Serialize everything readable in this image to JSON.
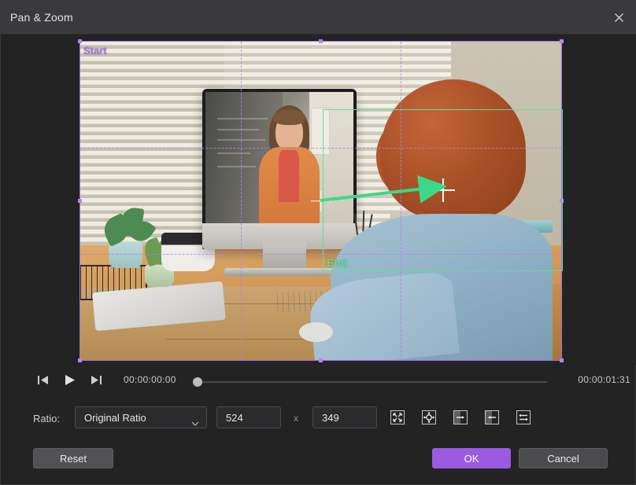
{
  "window": {
    "title": "Pan & Zoom",
    "close_icon": "close-icon"
  },
  "preview": {
    "start_marker_label": "Start",
    "end_marker_label": "End",
    "start_color": "#a46fe0",
    "end_color": "#57e29a",
    "arrow_color": "#3ad98a"
  },
  "transport": {
    "prev_frame_icon": "skip-previous-icon",
    "play_icon": "play-icon",
    "next_frame_icon": "skip-next-icon",
    "current_time": "00:00:00:00",
    "total_time": "00:00:01:31"
  },
  "ratio": {
    "label": "Ratio:",
    "select_value": "Original Ratio",
    "select_options": [
      "Original Ratio"
    ],
    "chevron_icon": "chevron-down-icon",
    "width_value": "524",
    "height_value": "349",
    "separator": "x",
    "tools": [
      {
        "name": "fit-to-frame-icon"
      },
      {
        "name": "center-move-icon"
      },
      {
        "name": "zoom-in-direction-icon"
      },
      {
        "name": "zoom-out-direction-icon"
      },
      {
        "name": "swap-start-end-icon"
      }
    ]
  },
  "footer": {
    "reset_label": "Reset",
    "ok_label": "OK",
    "cancel_label": "Cancel",
    "accent_color": "#9a5be0"
  }
}
